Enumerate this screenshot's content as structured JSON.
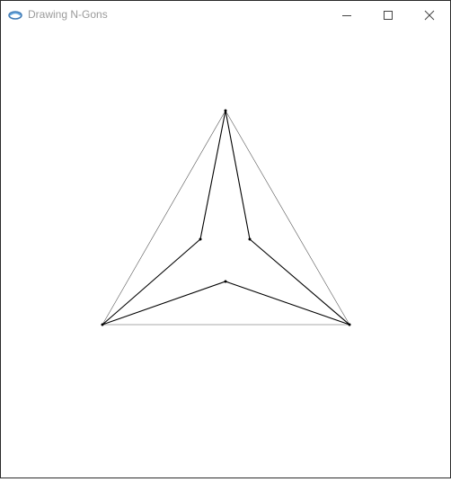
{
  "window": {
    "title": "Drawing N-Gons",
    "icon": "app-icon"
  },
  "controls": {
    "minimize_icon": "minimize-icon",
    "maximize_icon": "maximize-icon",
    "close_icon": "close-icon"
  },
  "colors": {
    "stroke": "#000000",
    "title_text": "#9a9a9a"
  }
}
